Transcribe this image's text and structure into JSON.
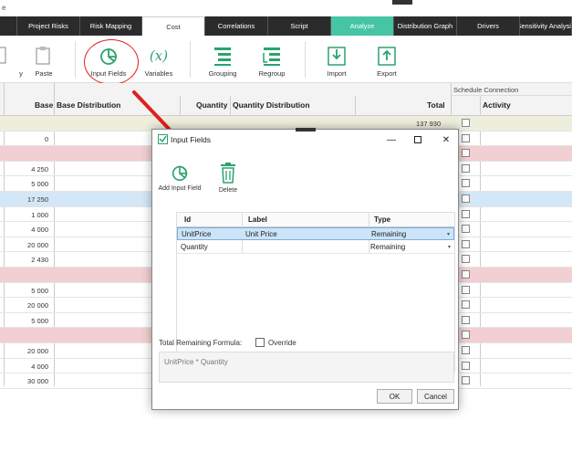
{
  "tabs": [
    {
      "label": "",
      "w": 19
    },
    {
      "label": "Project Risks",
      "w": 69
    },
    {
      "label": "Risk Mapping",
      "w": 68
    },
    {
      "label": "Cost",
      "w": 69,
      "active": true
    },
    {
      "label": "Correlations",
      "w": 69
    },
    {
      "label": "Script",
      "w": 69
    },
    {
      "label": "Analyze",
      "w": 69,
      "analyze": true
    },
    {
      "label": "Distribution Graph",
      "w": 69
    },
    {
      "label": "Drivers",
      "w": 69
    },
    {
      "label": "Sensitivity Analysis",
      "w": 57
    }
  ],
  "topstrip": {
    "title_fragment": "e"
  },
  "ribbon": {
    "copy_label": "y",
    "paste_label": "Paste",
    "input_fields_label": "Input Fields",
    "variables_label": "Variables",
    "grouping_label": "Grouping",
    "regroup_label": "Regroup",
    "import_label": "Import",
    "export_label": "Export"
  },
  "grid": {
    "schedule_connection": "Schedule Connection",
    "headers": {
      "base": "Base",
      "base_distribution": "Base Distribution",
      "quantity": "Quantity",
      "quantity_distribution": "Quantity Distribution",
      "total": "Total",
      "activity": "Activity"
    },
    "rows": [
      {
        "style": "olive",
        "base": "",
        "total": "137 930"
      },
      {
        "style": "white",
        "base": "0",
        "total": ""
      },
      {
        "style": "pink",
        "base": "",
        "total": ""
      },
      {
        "style": "white",
        "base": "4 250",
        "total": ""
      },
      {
        "style": "white",
        "base": "5 000",
        "total": ""
      },
      {
        "style": "blue",
        "base": "17 250",
        "total": ""
      },
      {
        "style": "white",
        "base": "1 000",
        "total": ""
      },
      {
        "style": "white",
        "base": "4 000",
        "total": ""
      },
      {
        "style": "white",
        "base": "20 000",
        "total": ""
      },
      {
        "style": "white",
        "base": "2 430",
        "total": ""
      },
      {
        "style": "pink",
        "base": "",
        "total": ""
      },
      {
        "style": "white",
        "base": "5 000",
        "total": ""
      },
      {
        "style": "white",
        "base": "20 000",
        "total": ""
      },
      {
        "style": "white",
        "base": "5 000",
        "total": ""
      },
      {
        "style": "pink",
        "base": "",
        "total": ""
      },
      {
        "style": "white",
        "base": "20 000",
        "total": ""
      },
      {
        "style": "white",
        "base": "4 000",
        "total": ""
      },
      {
        "style": "white",
        "base": "30 000",
        "total": ""
      }
    ]
  },
  "dialog": {
    "title": "Input Fields",
    "add_label": "Add Input Field",
    "delete_label": "Delete",
    "columns": {
      "id": "Id",
      "label": "Label",
      "type": "Type"
    },
    "fields": [
      {
        "id": "UnitPrice",
        "label": "Unit Price",
        "type": "Remaining",
        "selected": true
      },
      {
        "id": "Quantity",
        "label": "",
        "type": "Remaining",
        "selected": false
      }
    ],
    "formula_label": "Total Remaining Formula:",
    "override_label": "Override",
    "formula_text": "UnitPrice * Quantity",
    "ok_label": "OK",
    "cancel_label": "Cancel"
  },
  "colors": {
    "tabbar": "#2b2b2b",
    "analyze": "#45c5a4",
    "accent_green": "#2ba36e",
    "highlight_red": "#e02020",
    "row_pink": "#f2cfd2",
    "row_blue": "#d4e7f6",
    "row_olive": "#eeeedd"
  },
  "icons": {
    "copy": "copy-icon",
    "paste": "paste-icon",
    "input_fields": "pie-chart-icon",
    "variables": "function-icon",
    "grouping": "grouping-icon",
    "regroup": "regroup-icon",
    "import": "import-icon",
    "export": "export-icon",
    "delete": "trash-icon"
  }
}
